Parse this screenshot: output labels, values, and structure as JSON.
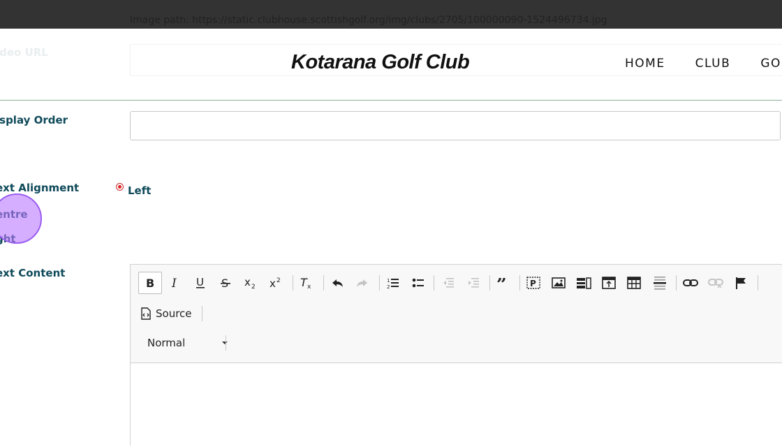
{
  "image_path_text": "Image path: https://static.clubhouse.scottishgolf.org/img/clubs/2705/100000090-1524496734.jpg",
  "site": {
    "logo": "Kotarana Golf Club",
    "nav": [
      "HOME",
      "CLUB",
      "GOL"
    ]
  },
  "form": {
    "video_url_label": "ideo URL",
    "display_order_label": "isplay Order",
    "display_order_value": "",
    "text_alignment_label": "ext Alignment",
    "alignment_options": [
      "Left",
      "entre",
      "ght"
    ],
    "alignment_selected": "Left",
    "text_content_label": "ext Content"
  },
  "editor": {
    "toolbar_icons": [
      "bold-icon",
      "italic-icon",
      "underline-icon",
      "strikethrough-icon",
      "subscript-icon",
      "superscript-icon",
      "remove-format-icon",
      "undo-icon",
      "redo-icon",
      "numbered-list-icon",
      "bulleted-list-icon",
      "decrease-indent-icon",
      "increase-indent-icon",
      "blockquote-icon",
      "paragraph-icon",
      "image-icon",
      "inline-image-icon",
      "iframe-icon",
      "table-icon",
      "horizontal-line-icon",
      "link-icon",
      "unlink-icon",
      "anchor-icon"
    ],
    "source_label": "Source",
    "format_value": "Normal",
    "content": ""
  },
  "colors": {
    "label": "#0f4a5a",
    "radio": "#e01e1e",
    "click_indicator": "#ba78ff",
    "topbar": "#333333"
  }
}
